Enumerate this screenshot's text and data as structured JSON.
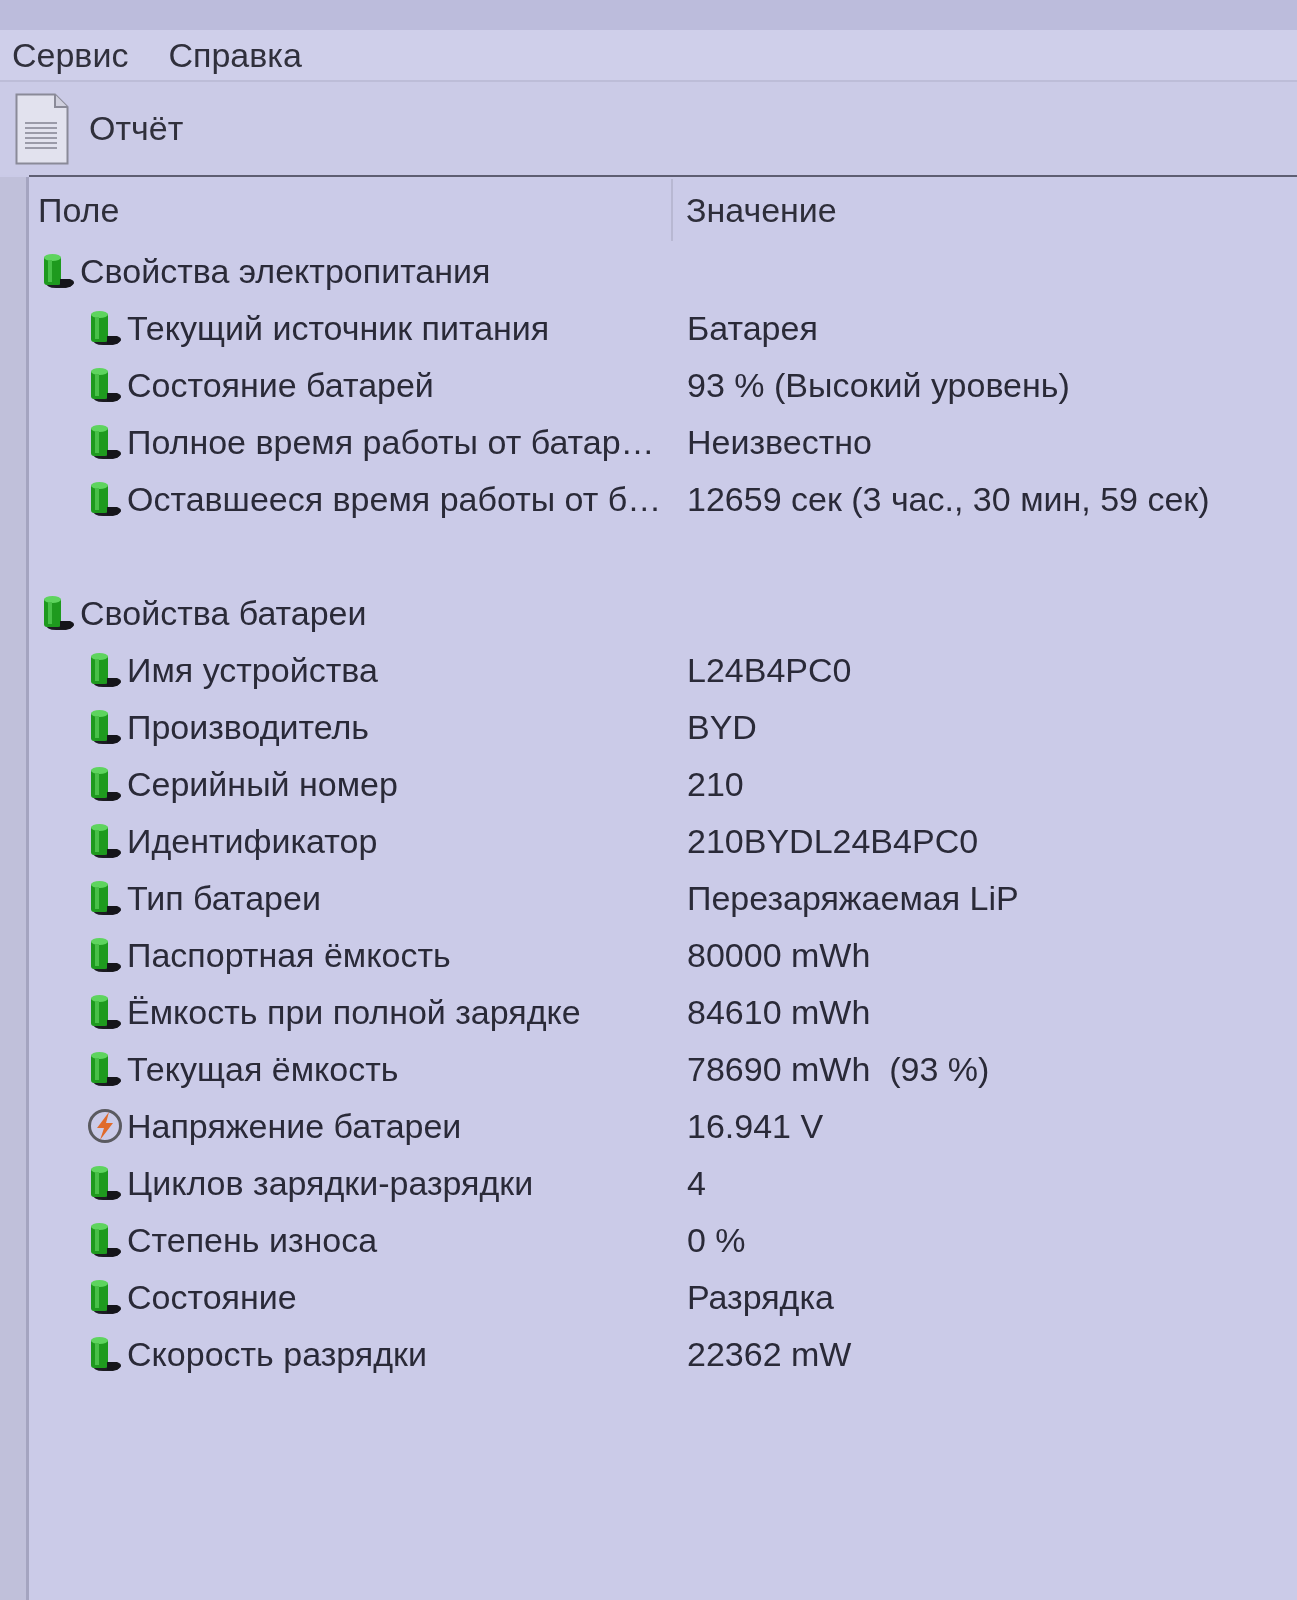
{
  "menu": [
    {
      "label": "Сервис"
    },
    {
      "label": "Справка"
    }
  ],
  "toolbar": [
    {
      "label": "Отчёт"
    }
  ],
  "table": {
    "columns": [
      "Поле",
      "Значение"
    ],
    "groups": [
      {
        "label": "Свойства электропитания",
        "kind": "battery",
        "children": [
          {
            "kind": "battery",
            "field": "Текущий источник питания",
            "value": "Батарея"
          },
          {
            "kind": "battery",
            "field": "Состояние батарей",
            "value": "93 % (Высокий уровень)"
          },
          {
            "kind": "battery",
            "field": "Полное время работы от батар…",
            "value": "Неизвестно"
          },
          {
            "kind": "battery",
            "field": "Оставшееся время работы от б…",
            "value": "12659 сек (3 час., 30 мин, 59 сек)"
          }
        ]
      },
      {
        "label": "Свойства батареи",
        "kind": "battery",
        "children": [
          {
            "kind": "battery",
            "field": "Имя устройства",
            "value": "L24B4PC0"
          },
          {
            "kind": "battery",
            "field": "Производитель",
            "value": "BYD"
          },
          {
            "kind": "battery",
            "field": "Серийный номер",
            "value": "210"
          },
          {
            "kind": "battery",
            "field": "Идентификатор",
            "value": "210BYDL24B4PC0"
          },
          {
            "kind": "battery",
            "field": "Тип батареи",
            "value": "Перезаряжаемая LiP"
          },
          {
            "kind": "battery",
            "field": "Паспортная ёмкость",
            "value": "80000 mWh"
          },
          {
            "kind": "battery",
            "field": "Ёмкость при полной зарядке",
            "value": "84610 mWh"
          },
          {
            "kind": "battery",
            "field": "Текущая ёмкость",
            "value": "78690 mWh  (93 %)"
          },
          {
            "kind": "voltage",
            "field": "Напряжение батареи",
            "value": "16.941 V"
          },
          {
            "kind": "battery",
            "field": "Циклов зарядки-разрядки",
            "value": "4"
          },
          {
            "kind": "battery",
            "field": "Степень износа",
            "value": "0 %"
          },
          {
            "kind": "battery",
            "field": "Состояние",
            "value": "Разрядка"
          },
          {
            "kind": "battery",
            "field": "Скорость разрядки",
            "value": "22362 mW"
          }
        ]
      }
    ]
  }
}
